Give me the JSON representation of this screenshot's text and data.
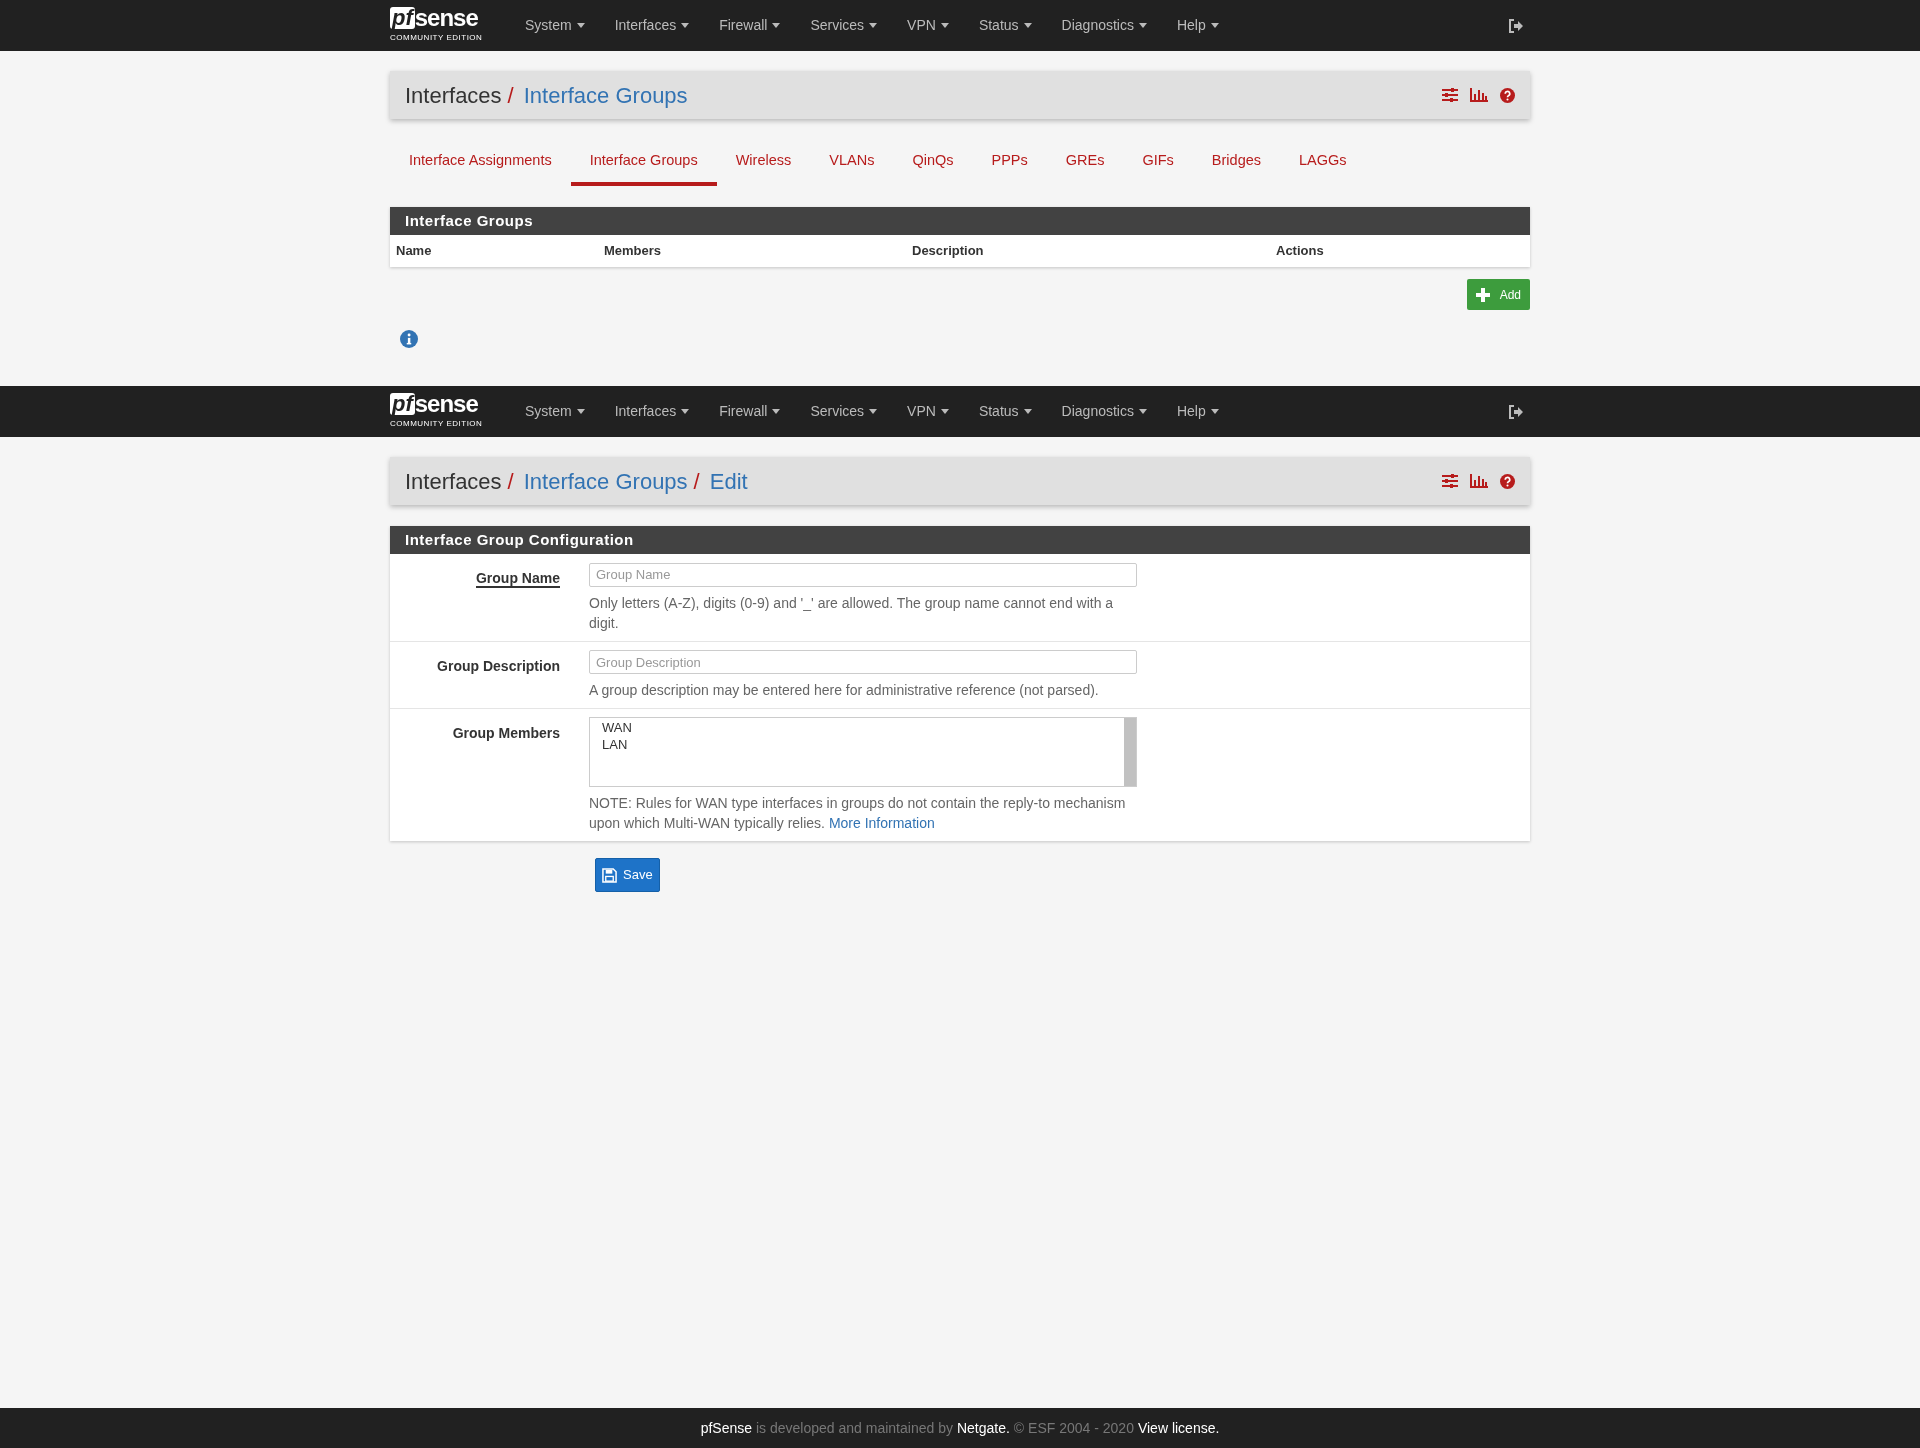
{
  "page_1": {
    "navbar": {
      "logo": {
        "mark": "pf",
        "word": "sense",
        "edition": "COMMUNITY EDITION"
      },
      "menu": [
        "System",
        "Interfaces",
        "Firewall",
        "Services",
        "VPN",
        "Status",
        "Diagnostics",
        "Help"
      ]
    },
    "breadcrumb": {
      "separator": "/",
      "items": [
        {
          "label": "Interfaces",
          "link": false
        },
        {
          "label": "Interface Groups",
          "link": true
        }
      ]
    },
    "tabs": [
      {
        "label": "Interface Assignments",
        "selected": false
      },
      {
        "label": "Interface Groups",
        "selected": true
      },
      {
        "label": "Wireless",
        "selected": false
      },
      {
        "label": "VLANs",
        "selected": false
      },
      {
        "label": "QinQs",
        "selected": false
      },
      {
        "label": "PPPs",
        "selected": false
      },
      {
        "label": "GREs",
        "selected": false
      },
      {
        "label": "GIFs",
        "selected": false
      },
      {
        "label": "Bridges",
        "selected": false
      },
      {
        "label": "LAGGs",
        "selected": false
      }
    ],
    "table": {
      "title": "Interface Groups",
      "columns": [
        "Name",
        "Members",
        "Description",
        "Actions"
      ]
    },
    "add_button": "Add"
  },
  "page_2": {
    "navbar": {
      "logo": {
        "mark": "pf",
        "word": "sense",
        "edition": "COMMUNITY EDITION"
      },
      "menu": [
        "System",
        "Interfaces",
        "Firewall",
        "Services",
        "VPN",
        "Status",
        "Diagnostics",
        "Help"
      ]
    },
    "breadcrumb": {
      "separator": "/",
      "items": [
        {
          "label": "Interfaces",
          "link": false
        },
        {
          "label": "Interface Groups",
          "link": true
        },
        {
          "label": "Edit",
          "link": true
        }
      ]
    },
    "form": {
      "title": "Interface Group Configuration",
      "rows": [
        {
          "kind": "text",
          "label": "Group Name",
          "required": true,
          "placeholder": "Group Name",
          "help": "Only letters (A-Z), digits (0-9) and '_' are allowed. The group name cannot end with a digit."
        },
        {
          "kind": "text",
          "label": "Group Description",
          "required": false,
          "placeholder": "Group Description",
          "help": "A group description may be entered here for administrative reference (not parsed)."
        },
        {
          "kind": "list",
          "label": "Group Members",
          "required": false,
          "options": [
            {
              "label": "WAN",
              "selected": false
            },
            {
              "label": "LAN",
              "selected": false
            }
          ],
          "help": "NOTE: Rules for WAN type interfaces in groups do not contain the reply-to mechanism upon which Multi-WAN typically relies.",
          "help_link": "More Information"
        }
      ]
    },
    "save_button": "Save"
  },
  "footer": [
    {
      "text": "pfSense",
      "kind": "strong"
    },
    {
      "text": "is developed and maintained by",
      "kind": "plain"
    },
    {
      "text": "Netgate.",
      "kind": "strong"
    },
    {
      "text": "© ESF 2004 - 2020",
      "kind": "plain"
    },
    {
      "text": "View license.",
      "kind": "strong"
    }
  ]
}
